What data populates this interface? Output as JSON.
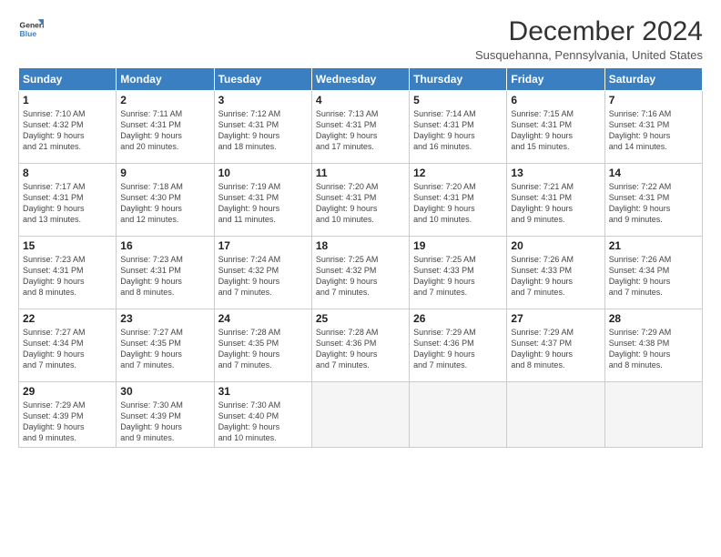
{
  "logo": {
    "line1": "General",
    "line2": "Blue"
  },
  "title": "December 2024",
  "subtitle": "Susquehanna, Pennsylvania, United States",
  "days_of_week": [
    "Sunday",
    "Monday",
    "Tuesday",
    "Wednesday",
    "Thursday",
    "Friday",
    "Saturday"
  ],
  "weeks": [
    [
      {
        "day": "1",
        "info": "Sunrise: 7:10 AM\nSunset: 4:32 PM\nDaylight: 9 hours\nand 21 minutes."
      },
      {
        "day": "2",
        "info": "Sunrise: 7:11 AM\nSunset: 4:31 PM\nDaylight: 9 hours\nand 20 minutes."
      },
      {
        "day": "3",
        "info": "Sunrise: 7:12 AM\nSunset: 4:31 PM\nDaylight: 9 hours\nand 18 minutes."
      },
      {
        "day": "4",
        "info": "Sunrise: 7:13 AM\nSunset: 4:31 PM\nDaylight: 9 hours\nand 17 minutes."
      },
      {
        "day": "5",
        "info": "Sunrise: 7:14 AM\nSunset: 4:31 PM\nDaylight: 9 hours\nand 16 minutes."
      },
      {
        "day": "6",
        "info": "Sunrise: 7:15 AM\nSunset: 4:31 PM\nDaylight: 9 hours\nand 15 minutes."
      },
      {
        "day": "7",
        "info": "Sunrise: 7:16 AM\nSunset: 4:31 PM\nDaylight: 9 hours\nand 14 minutes."
      }
    ],
    [
      {
        "day": "8",
        "info": "Sunrise: 7:17 AM\nSunset: 4:31 PM\nDaylight: 9 hours\nand 13 minutes."
      },
      {
        "day": "9",
        "info": "Sunrise: 7:18 AM\nSunset: 4:30 PM\nDaylight: 9 hours\nand 12 minutes."
      },
      {
        "day": "10",
        "info": "Sunrise: 7:19 AM\nSunset: 4:31 PM\nDaylight: 9 hours\nand 11 minutes."
      },
      {
        "day": "11",
        "info": "Sunrise: 7:20 AM\nSunset: 4:31 PM\nDaylight: 9 hours\nand 10 minutes."
      },
      {
        "day": "12",
        "info": "Sunrise: 7:20 AM\nSunset: 4:31 PM\nDaylight: 9 hours\nand 10 minutes."
      },
      {
        "day": "13",
        "info": "Sunrise: 7:21 AM\nSunset: 4:31 PM\nDaylight: 9 hours\nand 9 minutes."
      },
      {
        "day": "14",
        "info": "Sunrise: 7:22 AM\nSunset: 4:31 PM\nDaylight: 9 hours\nand 9 minutes."
      }
    ],
    [
      {
        "day": "15",
        "info": "Sunrise: 7:23 AM\nSunset: 4:31 PM\nDaylight: 9 hours\nand 8 minutes."
      },
      {
        "day": "16",
        "info": "Sunrise: 7:23 AM\nSunset: 4:31 PM\nDaylight: 9 hours\nand 8 minutes."
      },
      {
        "day": "17",
        "info": "Sunrise: 7:24 AM\nSunset: 4:32 PM\nDaylight: 9 hours\nand 7 minutes."
      },
      {
        "day": "18",
        "info": "Sunrise: 7:25 AM\nSunset: 4:32 PM\nDaylight: 9 hours\nand 7 minutes."
      },
      {
        "day": "19",
        "info": "Sunrise: 7:25 AM\nSunset: 4:33 PM\nDaylight: 9 hours\nand 7 minutes."
      },
      {
        "day": "20",
        "info": "Sunrise: 7:26 AM\nSunset: 4:33 PM\nDaylight: 9 hours\nand 7 minutes."
      },
      {
        "day": "21",
        "info": "Sunrise: 7:26 AM\nSunset: 4:34 PM\nDaylight: 9 hours\nand 7 minutes."
      }
    ],
    [
      {
        "day": "22",
        "info": "Sunrise: 7:27 AM\nSunset: 4:34 PM\nDaylight: 9 hours\nand 7 minutes."
      },
      {
        "day": "23",
        "info": "Sunrise: 7:27 AM\nSunset: 4:35 PM\nDaylight: 9 hours\nand 7 minutes."
      },
      {
        "day": "24",
        "info": "Sunrise: 7:28 AM\nSunset: 4:35 PM\nDaylight: 9 hours\nand 7 minutes."
      },
      {
        "day": "25",
        "info": "Sunrise: 7:28 AM\nSunset: 4:36 PM\nDaylight: 9 hours\nand 7 minutes."
      },
      {
        "day": "26",
        "info": "Sunrise: 7:29 AM\nSunset: 4:36 PM\nDaylight: 9 hours\nand 7 minutes."
      },
      {
        "day": "27",
        "info": "Sunrise: 7:29 AM\nSunset: 4:37 PM\nDaylight: 9 hours\nand 8 minutes."
      },
      {
        "day": "28",
        "info": "Sunrise: 7:29 AM\nSunset: 4:38 PM\nDaylight: 9 hours\nand 8 minutes."
      }
    ],
    [
      {
        "day": "29",
        "info": "Sunrise: 7:29 AM\nSunset: 4:39 PM\nDaylight: 9 hours\nand 9 minutes."
      },
      {
        "day": "30",
        "info": "Sunrise: 7:30 AM\nSunset: 4:39 PM\nDaylight: 9 hours\nand 9 minutes."
      },
      {
        "day": "31",
        "info": "Sunrise: 7:30 AM\nSunset: 4:40 PM\nDaylight: 9 hours\nand 10 minutes."
      },
      null,
      null,
      null,
      null
    ]
  ]
}
